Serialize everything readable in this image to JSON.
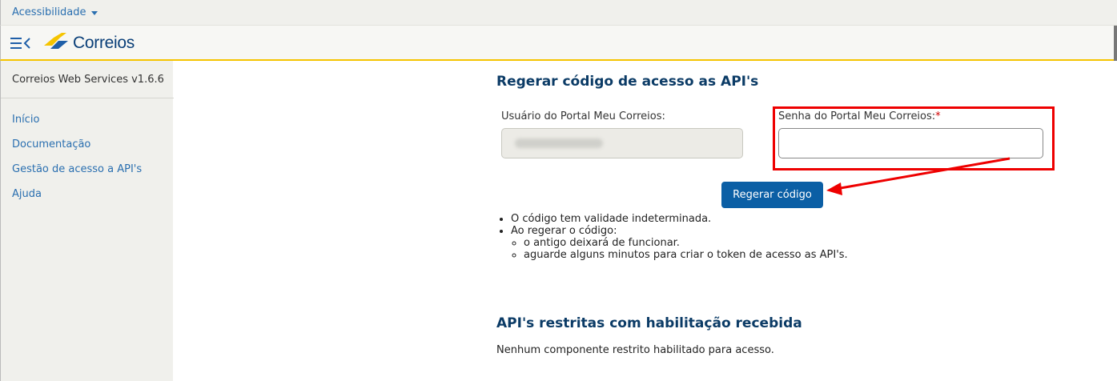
{
  "topbar": {
    "accessibility_label": "Acessibilidade"
  },
  "header": {
    "logo_text": "Correios"
  },
  "sidebar": {
    "version": "Correios Web Services v1.6.6",
    "items": [
      {
        "label": "Início"
      },
      {
        "label": "Documentação"
      },
      {
        "label": "Gestão de acesso a API's"
      },
      {
        "label": "Ajuda"
      }
    ]
  },
  "main": {
    "title": "Regerar código de acesso as API's",
    "user_label": "Usuário do Portal Meu Correios:",
    "password_label": "Senha do Portal Meu Correios:",
    "required_mark": "*",
    "regen_button": "Regerar código",
    "bullets": {
      "item1": "O código tem validade indeterminada.",
      "item2": "Ao regerar o código:",
      "sub1": "o antigo deixará de funcionar.",
      "sub2": "aguarde alguns minutos para criar o token de acesso as API's."
    },
    "restricted_title": "API's restritas com habilitação recebida",
    "restricted_text": "Nenhum componente restrito habilitado para acesso."
  },
  "colors": {
    "accent_blue": "#0b5fa5",
    "link_blue": "#2a6fb0",
    "brand_yellow": "#f5c400",
    "annotation_red": "#ee0000"
  }
}
